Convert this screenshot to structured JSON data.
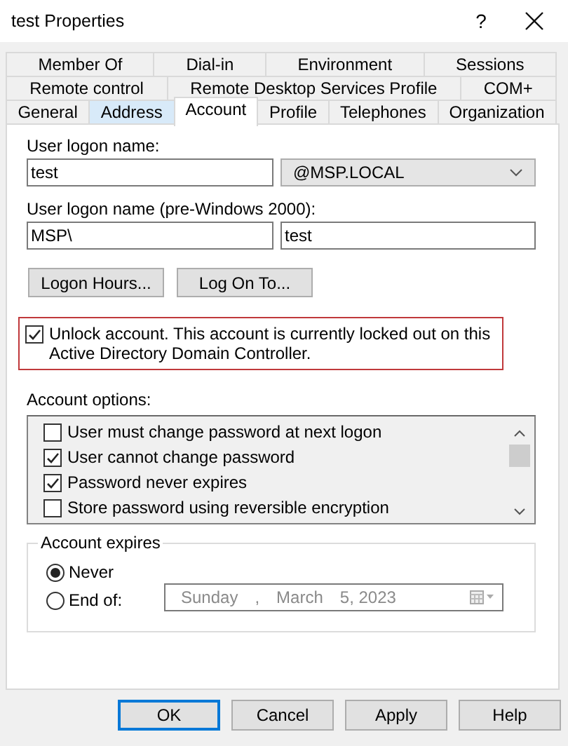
{
  "window": {
    "title": "test Properties",
    "help_button": "?"
  },
  "tab_rows": [
    [
      {
        "label": "Member Of",
        "selected": false,
        "hovered": false
      },
      {
        "label": "Dial-in",
        "selected": false,
        "hovered": false
      },
      {
        "label": "Environment",
        "selected": false,
        "hovered": false
      },
      {
        "label": "Sessions",
        "selected": false,
        "hovered": false
      }
    ],
    [
      {
        "label": "Remote control",
        "selected": false,
        "hovered": false
      },
      {
        "label": "Remote Desktop Services Profile",
        "selected": false,
        "hovered": false
      },
      {
        "label": "COM+",
        "selected": false,
        "hovered": false
      }
    ],
    [
      {
        "label": "General",
        "selected": false,
        "hovered": false
      },
      {
        "label": "Address",
        "selected": false,
        "hovered": true
      },
      {
        "label": "Account",
        "selected": true,
        "hovered": false
      },
      {
        "label": "Profile",
        "selected": false,
        "hovered": false
      },
      {
        "label": "Telephones",
        "selected": false,
        "hovered": false
      },
      {
        "label": "Organization",
        "selected": false,
        "hovered": false
      }
    ]
  ],
  "account": {
    "logon_name_label": "User logon name:",
    "logon_name": "test",
    "domain": "@MSP.LOCAL",
    "pre2000_label": "User logon name (pre-Windows 2000):",
    "pre2000_domain": "MSP\\",
    "pre2000_name": "test",
    "buttons": [
      "Logon Hours...",
      "Log On To..."
    ],
    "unlock": {
      "label": "Unlock account. This account is currently locked out on this Active Directory Domain Controller.",
      "checked": true,
      "highlighted": true
    },
    "options_label": "Account options:",
    "options": [
      {
        "label": "User must change password at next logon",
        "checked": false
      },
      {
        "label": "User cannot change password",
        "checked": true
      },
      {
        "label": "Password never expires",
        "checked": true
      },
      {
        "label": "Store password using reversible encryption",
        "checked": false
      }
    ],
    "expires": {
      "label": "Account expires",
      "choices": [
        {
          "label": "Never",
          "selected": true
        },
        {
          "label": "End of:",
          "selected": false
        }
      ],
      "date": {
        "disabled": true,
        "parts": [
          "Sunday",
          ",",
          "March",
          "5, 2023"
        ]
      }
    }
  },
  "footer_buttons": [
    {
      "label": "OK",
      "default": true
    },
    {
      "label": "Cancel",
      "default": false
    },
    {
      "label": "Apply",
      "default": false
    },
    {
      "label": "Help",
      "default": false
    }
  ]
}
